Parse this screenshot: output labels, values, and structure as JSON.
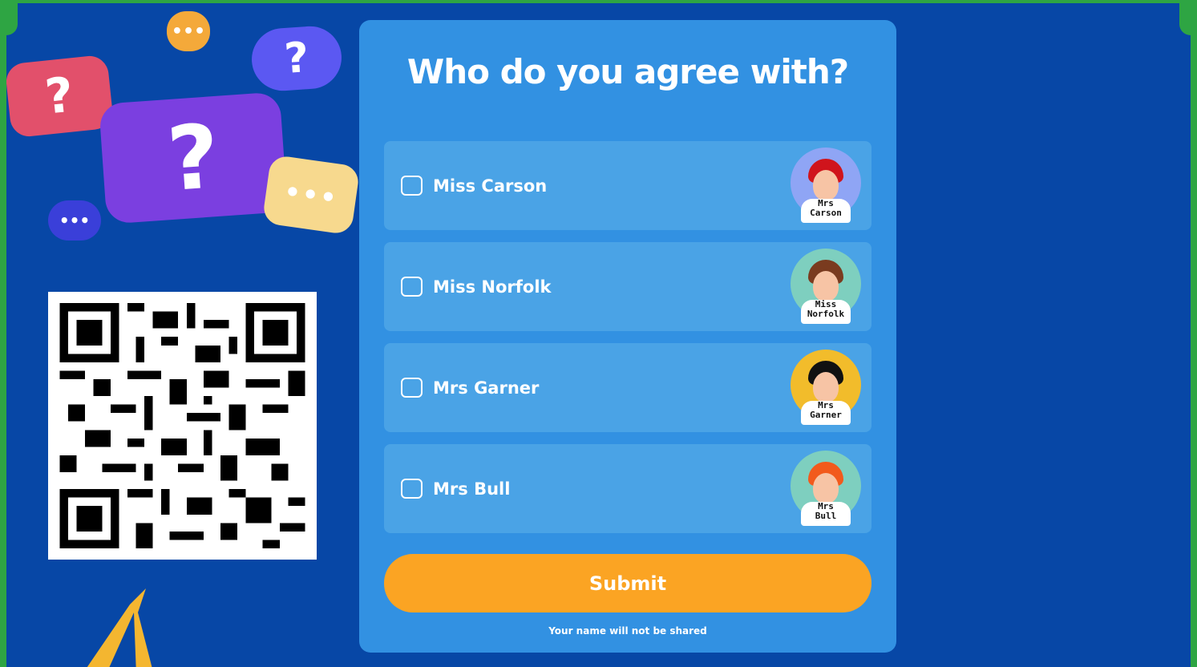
{
  "colors": {
    "border_green": "#2ea543",
    "background_blue": "#0747a6",
    "card_blue": "#3291e2",
    "option_blue": "#4aa3e6",
    "submit_orange": "#fba423"
  },
  "decor": {
    "question_mark": "?",
    "ellipsis": "•••"
  },
  "poll": {
    "title": "Who do you agree with?",
    "options": [
      {
        "label": "Miss Carson",
        "avatar_tag_1": "Mrs",
        "avatar_tag_2": "Carson",
        "avatar_bg": "#8fa5f5",
        "hair": "#d0141c"
      },
      {
        "label": "Miss Norfolk",
        "avatar_tag_1": "Miss",
        "avatar_tag_2": "Norfolk",
        "avatar_bg": "#7ecfbf",
        "hair": "#7a3b1f"
      },
      {
        "label": "Mrs Garner",
        "avatar_tag_1": "Mrs",
        "avatar_tag_2": "Garner",
        "avatar_bg": "#f2bc2b",
        "hair": "#111111"
      },
      {
        "label": "Mrs Bull",
        "avatar_tag_1": "Mrs",
        "avatar_tag_2": "Bull",
        "avatar_bg": "#7ecfbf",
        "hair": "#f25a1c"
      }
    ],
    "submit_label": "Submit",
    "privacy_note": "Your name will not be shared"
  }
}
